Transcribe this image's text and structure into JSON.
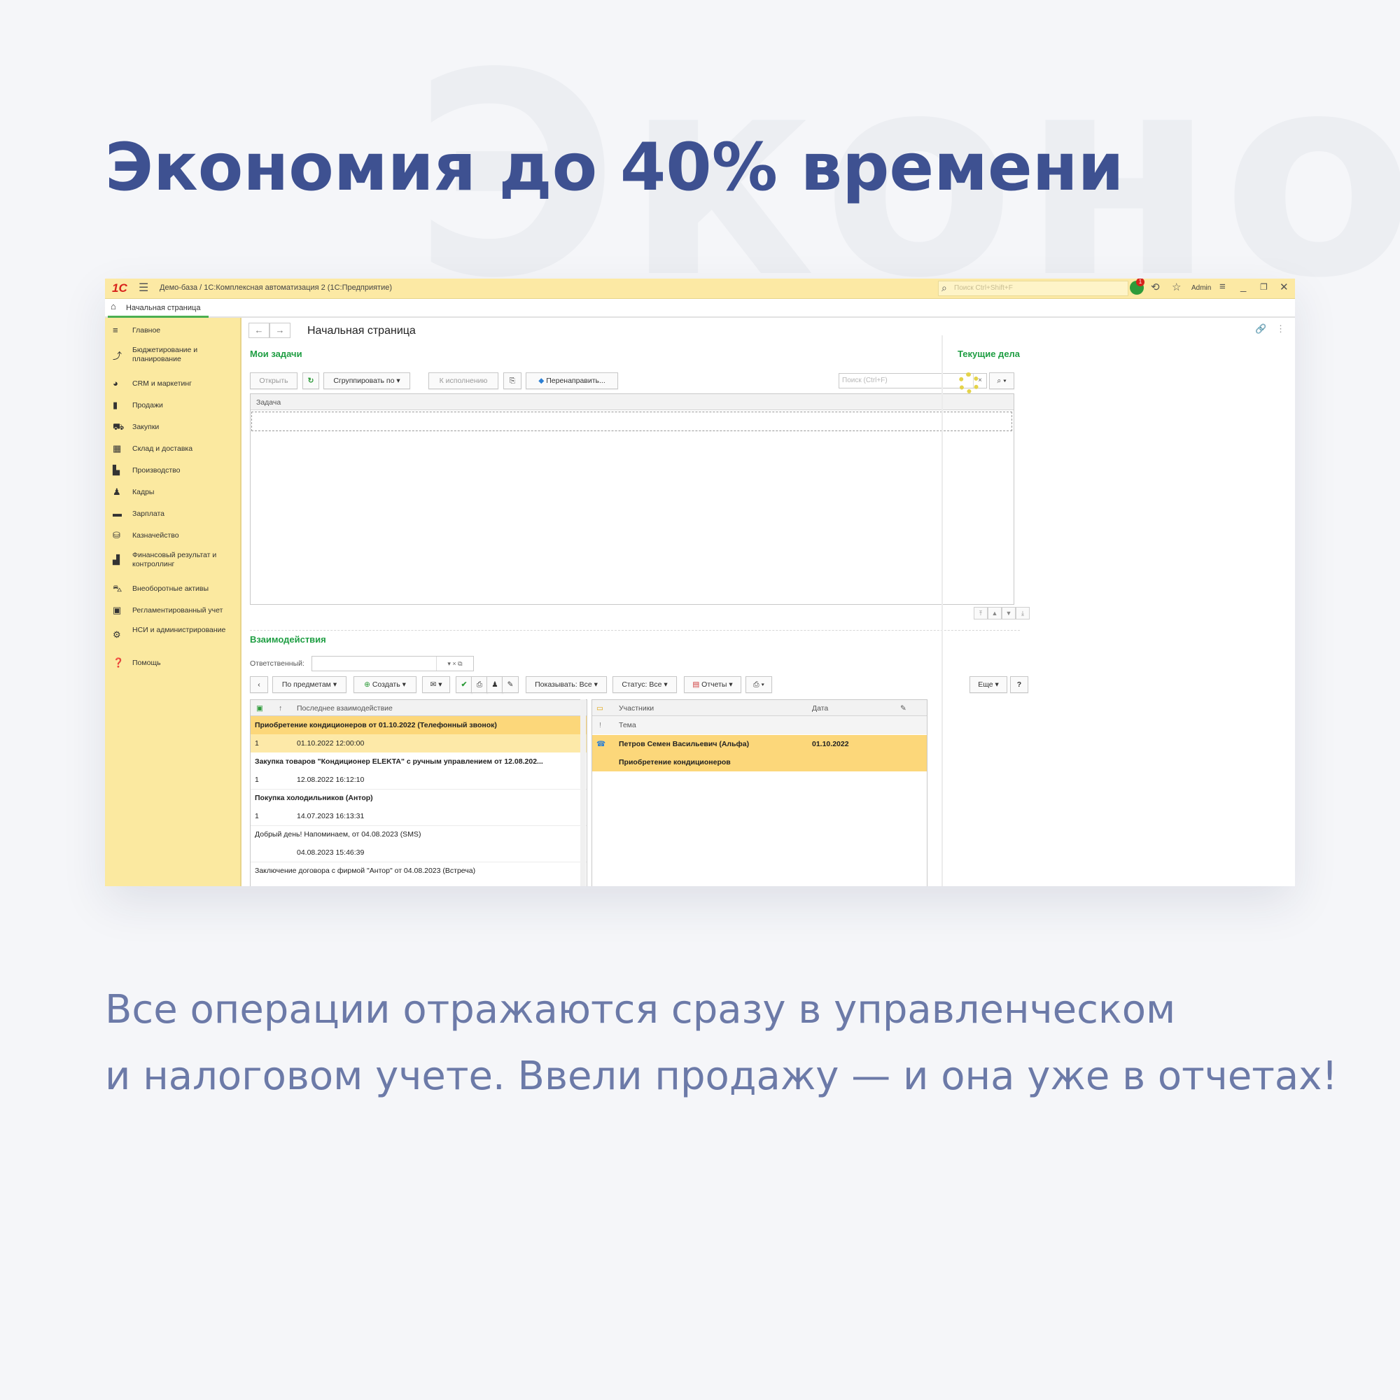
{
  "background_word": "Эконо",
  "headline": "Экономия до 40% времени",
  "description": {
    "line1": "Все операции отражаются сразу в управленческом",
    "line2": "и налоговом учете. Ввели продажу — и она уже в отчетах!"
  },
  "app": {
    "logo": "1С",
    "title": "Демо-база / 1С:Комплексная автоматизация 2  (1С:Предприятие)",
    "search_placeholder": "Поиск Ctrl+Shift+F",
    "notifications_count": "1",
    "user": "Admin",
    "home_tab": "Начальная страница",
    "accent_color": "#fbe9a0",
    "section_color": "#1f9e43"
  },
  "sidebar": {
    "items": [
      {
        "label": "Главное",
        "icon": "menu-icon"
      },
      {
        "label": "Бюджетирование и планирование",
        "icon": "chart-icon"
      },
      {
        "label": "CRM и маркетинг",
        "icon": "crm-icon"
      },
      {
        "label": "Продажи",
        "icon": "bag-icon"
      },
      {
        "label": "Закупки",
        "icon": "cart-icon"
      },
      {
        "label": "Склад и доставка",
        "icon": "warehouse-icon"
      },
      {
        "label": "Производство",
        "icon": "factory-icon"
      },
      {
        "label": "Кадры",
        "icon": "person-icon"
      },
      {
        "label": "Зарплата",
        "icon": "wallet-icon"
      },
      {
        "label": "Казначейство",
        "icon": "coins-icon"
      },
      {
        "label": "Финансовый результат и контроллинг",
        "icon": "bars-icon"
      },
      {
        "label": "Внеоборотные активы",
        "icon": "car-icon"
      },
      {
        "label": "Регламентированный учет",
        "icon": "lock-icon"
      },
      {
        "label": "НСИ и администрирование",
        "icon": "gear-icon"
      },
      {
        "label": "Помощь",
        "icon": "help-icon"
      }
    ]
  },
  "page": {
    "title": "Начальная страница",
    "tasks": {
      "title": "Мои задачи",
      "open": "Открыть",
      "group_by": "Сгруппировать по",
      "to_execute": "К исполнению",
      "redirect": "Перенаправить...",
      "search_placeholder": "Поиск (Ctrl+F)",
      "column": "Задача"
    },
    "interactions": {
      "title": "Взаимодействия",
      "responsible_label": "Ответственный:",
      "by_subject": "По предметам",
      "create": "Создать",
      "show": "Показывать: Все",
      "status": "Статус: Все",
      "reports": "Отчеты",
      "more": "Еще",
      "help": "?",
      "left_column": "Последнее взаимодействие",
      "rows": [
        {
          "title": "Приобретение кондиционеров от 01.10.2022 (Телефонный звонок)",
          "count": "1",
          "date": "01.10.2022 12:00:00"
        },
        {
          "title": "Закупка товаров \"Кондиционер ELEKTA\" с ручным управлением от 12.08.202...",
          "count": "1",
          "date": "12.08.2022 16:12:10"
        },
        {
          "title": "Покупка холодильников (Антор)",
          "count": "1",
          "date": "14.07.2023 16:13:31"
        },
        {
          "title": "Добрый день! Напоминаем, от 04.08.2023 (SMS)",
          "count": "",
          "date": "04.08.2023 15:46:39"
        },
        {
          "title": "Заключение договора с фирмой \"Антор\" от 04.08.2023 (Встреча)",
          "count": "",
          "date": ""
        }
      ],
      "right_columns": {
        "participants": "Участники",
        "date": "Дата",
        "topic": "Тема"
      },
      "detail": {
        "participants": "Петров Семен Васильевич (Альфа)",
        "date": "01.10.2022",
        "topic": "Приобретение кондиционеров"
      }
    },
    "current_tasks": {
      "title": "Текущие дела"
    }
  }
}
